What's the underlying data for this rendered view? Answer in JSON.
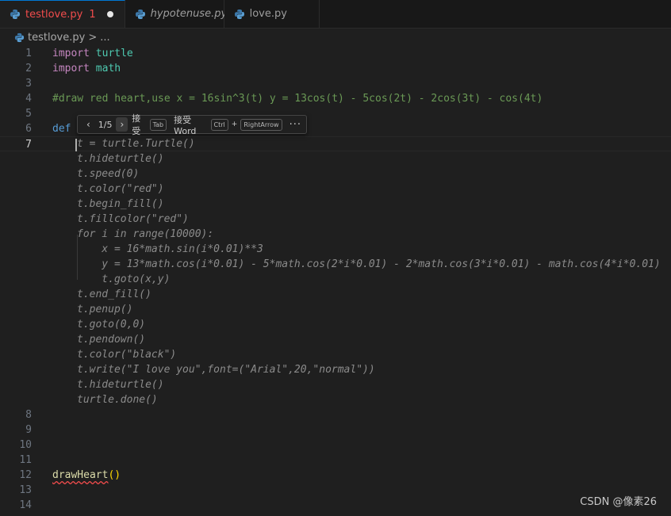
{
  "tabs": [
    {
      "label": "testlove.py",
      "badge": "1",
      "modified": true,
      "active": true,
      "italic": false,
      "icon": "python-icon"
    },
    {
      "label": "hypotenuse.py",
      "active": false,
      "italic": true,
      "icon": "python-icon"
    },
    {
      "label": "love.py",
      "active": false,
      "italic": false,
      "icon": "python-icon"
    }
  ],
  "breadcrumb": {
    "file": "testlove.py",
    "separator": ">",
    "tail": "..."
  },
  "lines": {
    "n1": "1",
    "c1_kw": "import",
    "c1_mod": "turtle",
    "n2": "2",
    "c2_kw": "import",
    "c2_mod": "math",
    "n3": "3",
    "n4": "4",
    "c4": "#draw red heart,use x = 16sin^3(t) y = 13cos(t) - 5cos(2t) - 2cos(3t) - cos(4t)",
    "n5": "5",
    "n6": "6",
    "c6_kw": "def",
    "n7": "7",
    "n8": "8",
    "n9": "9",
    "n10": "10",
    "n11": "11",
    "n12": "12",
    "c12_fn": "drawHeart",
    "c12_paren": "()",
    "n13": "13",
    "n14": "14"
  },
  "ghost_text": [
    "t = turtle.Turtle()",
    "t.hideturtle()",
    "t.speed(0)",
    "t.color(\"red\")",
    "t.begin_fill()",
    "t.fillcolor(\"red\")",
    "for i in range(10000):",
    "    x = 16*math.sin(i*0.01)**3",
    "    y = 13*math.cos(i*0.01) - 5*math.cos(2*i*0.01) - 2*math.cos(3*i*0.01) - math.cos(4*i*0.01)",
    "    t.goto(x,y)",
    "t.end_fill()",
    "t.penup()",
    "t.goto(0,0)",
    "t.pendown()",
    "t.color(\"black\")",
    "t.write(\"I love you\",font=(\"Arial\",20,\"normal\"))",
    "t.hideturtle()",
    "turtle.done()"
  ],
  "suggestion_widget": {
    "prev_icon": "chevron-left-icon",
    "counter": "1/5",
    "next_icon": "chevron-right-icon",
    "accept_label": "接受",
    "accept_key": "Tab",
    "accept_word_label": "接受 Word",
    "accept_word_key1": "Ctrl",
    "plus": "+",
    "accept_word_key2": "RightArrow",
    "more": "···"
  },
  "watermark": "CSDN @像素26",
  "colors": {
    "keyword": "#c586c0",
    "def": "#569cd6",
    "module": "#4ec9b0",
    "comment": "#6a9955",
    "function": "#dcdcaa",
    "error": "#f14c4c",
    "accent": "#0078d4"
  }
}
